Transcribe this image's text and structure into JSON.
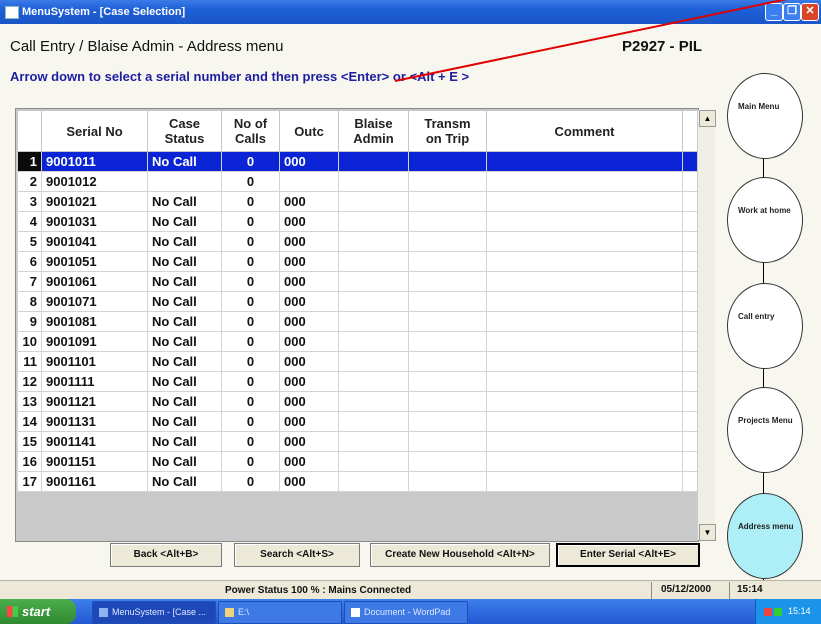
{
  "window": {
    "title": "MenuSystem - [Case Selection]"
  },
  "header": {
    "title": "Call Entry / Blaise Admin - Address menu",
    "project_code": "P2927 - PIL",
    "instruction": "Arrow down to select a serial number and then press <Enter> or <Alt + E >"
  },
  "grid": {
    "headers": {
      "serial": "Serial No",
      "case_status_1": "Case",
      "case_status_2": "Status",
      "calls_1": "No of",
      "calls_2": "Calls",
      "outc": "Outc",
      "blaise_1": "Blaise",
      "blaise_2": "Admin",
      "transm_1": "Transm",
      "transm_2": "on Trip",
      "comment": "Comment"
    },
    "selected_row": 0,
    "rows": [
      {
        "n": "1",
        "serial": "9001011",
        "status": "No Call",
        "calls": "0",
        "outc": "000"
      },
      {
        "n": "2",
        "serial": "9001012",
        "status": "",
        "calls": "0",
        "outc": ""
      },
      {
        "n": "3",
        "serial": "9001021",
        "status": "No Call",
        "calls": "0",
        "outc": "000"
      },
      {
        "n": "4",
        "serial": "9001031",
        "status": "No Call",
        "calls": "0",
        "outc": "000"
      },
      {
        "n": "5",
        "serial": "9001041",
        "status": "No Call",
        "calls": "0",
        "outc": "000"
      },
      {
        "n": "6",
        "serial": "9001051",
        "status": "No Call",
        "calls": "0",
        "outc": "000"
      },
      {
        "n": "7",
        "serial": "9001061",
        "status": "No Call",
        "calls": "0",
        "outc": "000"
      },
      {
        "n": "8",
        "serial": "9001071",
        "status": "No Call",
        "calls": "0",
        "outc": "000"
      },
      {
        "n": "9",
        "serial": "9001081",
        "status": "No Call",
        "calls": "0",
        "outc": "000"
      },
      {
        "n": "10",
        "serial": "9001091",
        "status": "No Call",
        "calls": "0",
        "outc": "000"
      },
      {
        "n": "11",
        "serial": "9001101",
        "status": "No Call",
        "calls": "0",
        "outc": "000"
      },
      {
        "n": "12",
        "serial": "9001111",
        "status": "No Call",
        "calls": "0",
        "outc": "000"
      },
      {
        "n": "13",
        "serial": "9001121",
        "status": "No Call",
        "calls": "0",
        "outc": "000"
      },
      {
        "n": "14",
        "serial": "9001131",
        "status": "No Call",
        "calls": "0",
        "outc": "000"
      },
      {
        "n": "15",
        "serial": "9001141",
        "status": "No Call",
        "calls": "0",
        "outc": "000"
      },
      {
        "n": "16",
        "serial": "9001151",
        "status": "No Call",
        "calls": "0",
        "outc": "000"
      },
      {
        "n": "17",
        "serial": "9001161",
        "status": "No Call",
        "calls": "0",
        "outc": "000"
      }
    ]
  },
  "buttons": {
    "back": "Back <Alt+B>",
    "search": "Search <Alt+S>",
    "create": "Create New Household <Alt+N>",
    "enter": "Enter Serial <Alt+E>"
  },
  "nav": {
    "main_menu": "Main Menu",
    "work_at_home": "Work at home",
    "call_entry": "Call entry",
    "projects_menu": "Projects Menu",
    "address_menu": "Address menu"
  },
  "status": {
    "message": "Power Status 100 % : Mains Connected",
    "date": "05/12/2000",
    "time": "15:14"
  },
  "taskbar": {
    "start": "start",
    "task1": "MenuSystem - [Case ...",
    "task2": "E:\\",
    "task3": "Document - WordPad",
    "clock": "15:14"
  },
  "colors": {
    "selection": "#0a24d6",
    "instruction_text": "#1e1ea0",
    "annotation_line": "#e00000",
    "active_nav": "#aeeef6"
  }
}
